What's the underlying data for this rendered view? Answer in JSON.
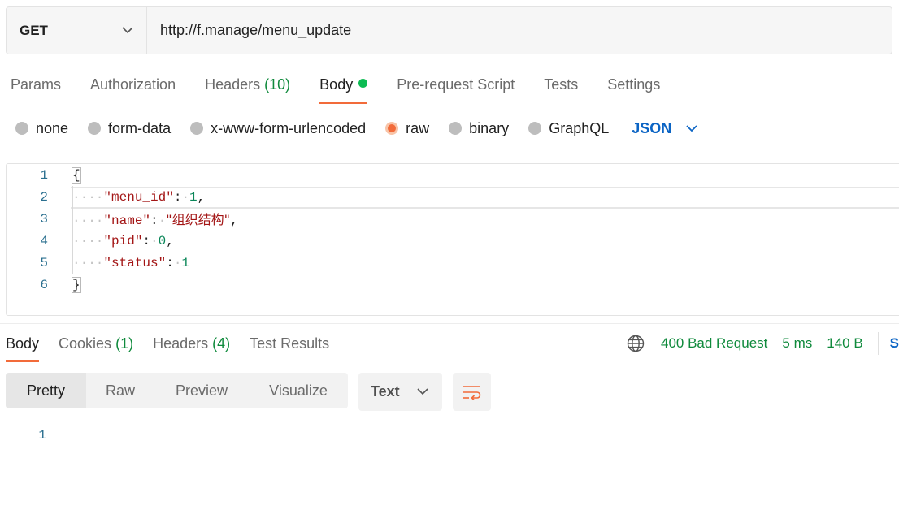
{
  "request": {
    "method": "GET",
    "url": "http://f.manage/menu_update"
  },
  "request_tabs": [
    {
      "label": "Params"
    },
    {
      "label": "Authorization"
    },
    {
      "label": "Headers",
      "count": "(10)"
    },
    {
      "label": "Body"
    },
    {
      "label": "Pre-request Script"
    },
    {
      "label": "Tests"
    },
    {
      "label": "Settings"
    }
  ],
  "body_types": [
    {
      "label": "none"
    },
    {
      "label": "form-data"
    },
    {
      "label": "x-www-form-urlencoded"
    },
    {
      "label": "raw"
    },
    {
      "label": "binary"
    },
    {
      "label": "GraphQL"
    }
  ],
  "body_format": "JSON",
  "editor": {
    "line_numbers": [
      "1",
      "2",
      "3",
      "4",
      "5",
      "6"
    ],
    "open_brace": "{",
    "close_brace": "}",
    "fields": [
      {
        "key": "\"menu_id\"",
        "value": "1",
        "comma": ","
      },
      {
        "key": "\"name\"",
        "value": "\"组织结构\"",
        "comma": ","
      },
      {
        "key": "\"pid\"",
        "value": "0",
        "comma": ","
      },
      {
        "key": "\"status\"",
        "value": "1",
        "comma": ""
      }
    ]
  },
  "response_tabs": [
    {
      "label": "Body"
    },
    {
      "label": "Cookies",
      "count": "(1)"
    },
    {
      "label": "Headers",
      "count": "(4)"
    },
    {
      "label": "Test Results"
    }
  ],
  "response_status": {
    "status": "400 Bad Request",
    "time": "5 ms",
    "size": "140 B",
    "save_label": "S"
  },
  "view_modes": [
    "Pretty",
    "Raw",
    "Preview",
    "Visualize"
  ],
  "response_format": "Text",
  "response_lines": [
    "1"
  ],
  "colors": {
    "accent": "#f26b3a",
    "link": "#0b64c4",
    "success": "#0f8a3c"
  }
}
